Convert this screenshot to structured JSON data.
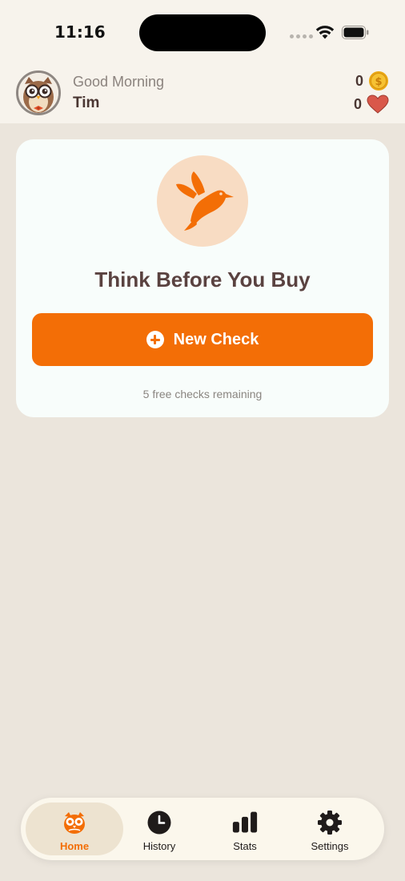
{
  "status_bar": {
    "time": "11:16",
    "icons": [
      "cellular-signal-icon",
      "wifi-icon",
      "battery-icon"
    ]
  },
  "header": {
    "greeting": "Good Morning",
    "username": "Tim",
    "avatar": "owl-avatar",
    "coins": {
      "count": "0",
      "icon": "coin-icon"
    },
    "hearts": {
      "count": "0",
      "icon": "heart-icon"
    }
  },
  "main_card": {
    "icon": "hummingbird-icon",
    "title": "Think Before You Buy",
    "button_label": "New Check",
    "button_icon": "plus-circle-icon",
    "remaining_text": "5 free checks remaining"
  },
  "tabbar": {
    "tabs": [
      {
        "label": "Home",
        "icon": "owl-icon",
        "active": true
      },
      {
        "label": "History",
        "icon": "clock-icon",
        "active": false
      },
      {
        "label": "Stats",
        "icon": "bar-chart-icon",
        "active": false
      },
      {
        "label": "Settings",
        "icon": "gear-icon",
        "active": false
      }
    ]
  },
  "colors": {
    "accent": "#f36e06",
    "background": "#ebe5dc",
    "card": "#f8fdfb",
    "header_bg": "#f7f3ec",
    "bird_circle": "#f8dcc3",
    "heart": "#d9584a",
    "coin": "#f2b21d"
  }
}
